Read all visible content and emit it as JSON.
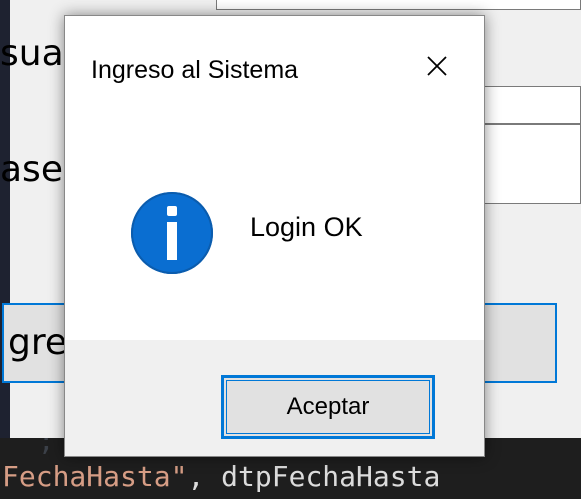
{
  "background_form": {
    "user_label_fragment": "sua",
    "password_label_fragment": "ase",
    "button_label_fragment": "gre"
  },
  "code_editor": {
    "line_prefix": "FechaHasta\"",
    "line_suffix": ", dtpFechaHasta"
  },
  "dialog": {
    "title": "Ingreso al Sistema",
    "message": "Login OK",
    "icon": "info-icon",
    "ok_label": "Aceptar",
    "close_icon": "close-icon"
  },
  "colors": {
    "accent": "#0078d7",
    "info_icon": "#0a6ed1",
    "form_bg": "#f0f0f0",
    "editor_bg": "#1e1e1e",
    "string_color": "#d69d85"
  }
}
